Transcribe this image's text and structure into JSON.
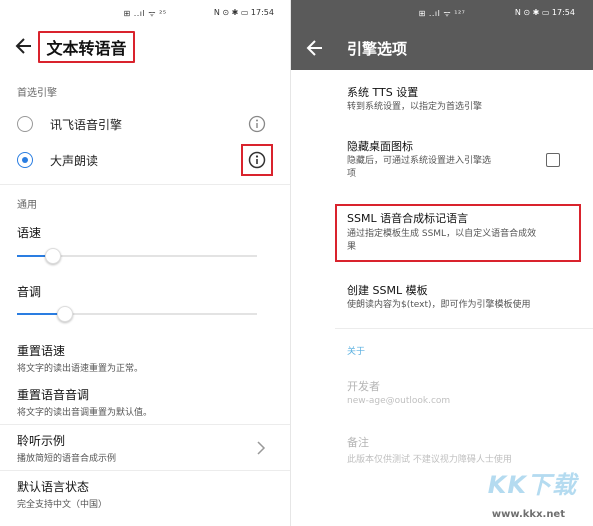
{
  "left": {
    "statusbar": {
      "center": "⊞ ..ıl ᯤ ²⁵",
      "right": "N ⊙ ✱ ▭ 17:54"
    },
    "title": "文本转语音",
    "preferred_engine_label": "首选引擎",
    "engines": [
      {
        "label": "讯飞语音引擎",
        "checked": false
      },
      {
        "label": "大声朗读",
        "checked": true
      }
    ],
    "general_label": "通用",
    "speech_rate": {
      "label": "语速",
      "value_fraction": 0.15
    },
    "pitch": {
      "label": "音调",
      "value_fraction": 0.2
    },
    "rows": [
      {
        "title": "重置语速",
        "subtitle": "将文字的读出语速重置为正常。"
      },
      {
        "title": "重置语音音调",
        "subtitle": "将文字的读出音调重置为默认值。"
      },
      {
        "title": "聆听示例",
        "subtitle": "播放简短的语音合成示例"
      },
      {
        "title": "默认语言状态",
        "subtitle": "完全支持中文（中国）"
      }
    ]
  },
  "right": {
    "statusbar": {
      "center": "⊞ ..ıl ᯤ ¹²⁷",
      "right": "N ⊙ ✱ ▭ 17:54"
    },
    "title": "引擎选项",
    "items": [
      {
        "title": "系统 TTS 设置",
        "subtitle": "转到系统设置，以指定为首选引擎"
      },
      {
        "title": "隐藏桌面图标",
        "subtitle_line1": "隐藏后，可通过系统设置进入引擎选",
        "subtitle_line2": "项",
        "checkbox_checked": false
      },
      {
        "title": "SSML 语音合成标记语言",
        "subtitle_line1": "通过指定模板生成 SSML，以自定义语音合成效",
        "subtitle_line2": "果"
      },
      {
        "title": "创建 SSML 模板",
        "subtitle": "使朗读内容为$(text)，即可作为引擎模板使用"
      }
    ],
    "about_label": "关于",
    "developer": {
      "title": "开发者",
      "subtitle": "new-age@outlook.com"
    },
    "note": {
      "title": "备注",
      "subtitle": "此版本仅供测试 不建议视力障碍人士使用"
    }
  },
  "watermark": {
    "text": "KK下载",
    "url": "www.kkx.net"
  },
  "colors": {
    "accent": "#2a7de1",
    "highlight": "#d9232d",
    "appbar": "#5a5a5a",
    "section": "#5ab0e0"
  }
}
